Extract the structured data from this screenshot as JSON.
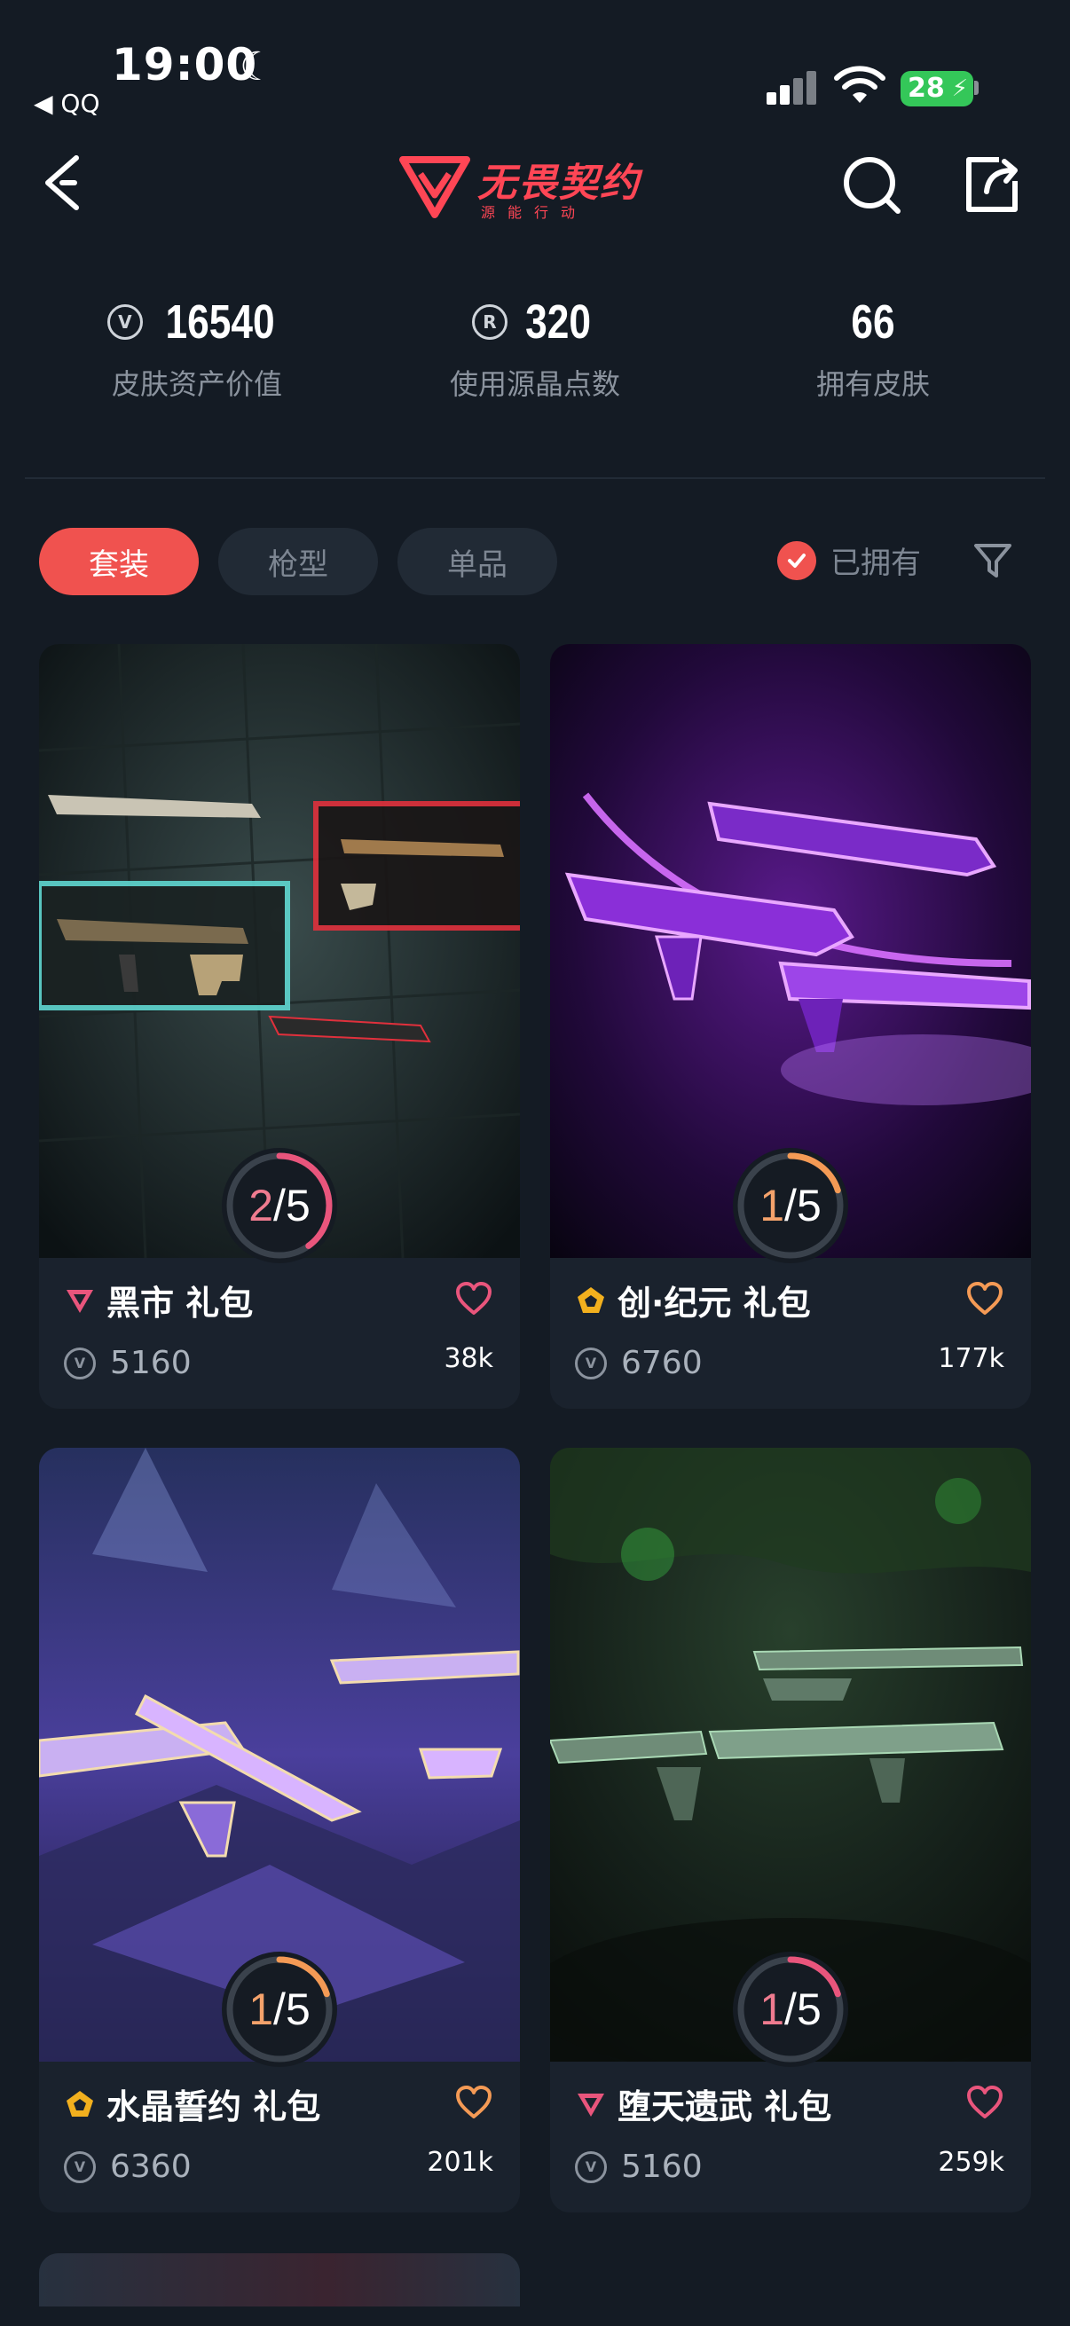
{
  "status_bar": {
    "time": "19:00",
    "back_app": "◀ QQ",
    "battery": "28"
  },
  "header": {
    "logo_title": "无畏契约",
    "logo_subtitle": "源能行动"
  },
  "stats": [
    {
      "value": "16540",
      "label": "皮肤资产价值",
      "icon": "vp-coin-icon"
    },
    {
      "value": "320",
      "label": "使用源晶点数",
      "icon": "radianite-icon"
    },
    {
      "value": "66",
      "label": "拥有皮肤",
      "icon": ""
    }
  ],
  "filters": {
    "tabs": [
      "套装",
      "枪型",
      "单品"
    ],
    "active_tab": "套装",
    "owned_label": "已拥有"
  },
  "bundles": [
    {
      "name": "黑市 礼包",
      "price": "5160",
      "likes": "38k",
      "owned": "2",
      "total": "/5",
      "progress": 0.4,
      "tier": "premium",
      "tier_color": "#e9557c",
      "heart_color": "#e9557c"
    },
    {
      "name": "创·纪元 礼包",
      "price": "6760",
      "likes": "177k",
      "owned": "1",
      "total": "/5",
      "progress": 0.2,
      "tier": "exclusive",
      "tier_color": "#f2b01e",
      "heart_color": "#f49a55"
    },
    {
      "name": "水晶誓约 礼包",
      "price": "6360",
      "likes": "201k",
      "owned": "1",
      "total": "/5",
      "progress": 0.2,
      "tier": "exclusive",
      "tier_color": "#f2b01e",
      "heart_color": "#f49a55"
    },
    {
      "name": "堕天遗武 礼包",
      "price": "5160",
      "likes": "259k",
      "owned": "1",
      "total": "/5",
      "progress": 0.2,
      "tier": "premium",
      "tier_color": "#e9557c",
      "heart_color": "#e9557c"
    }
  ],
  "colors": {
    "accent": "#f0524f",
    "brand": "#ff4655",
    "background": "#141b24",
    "card": "#1a222d"
  }
}
